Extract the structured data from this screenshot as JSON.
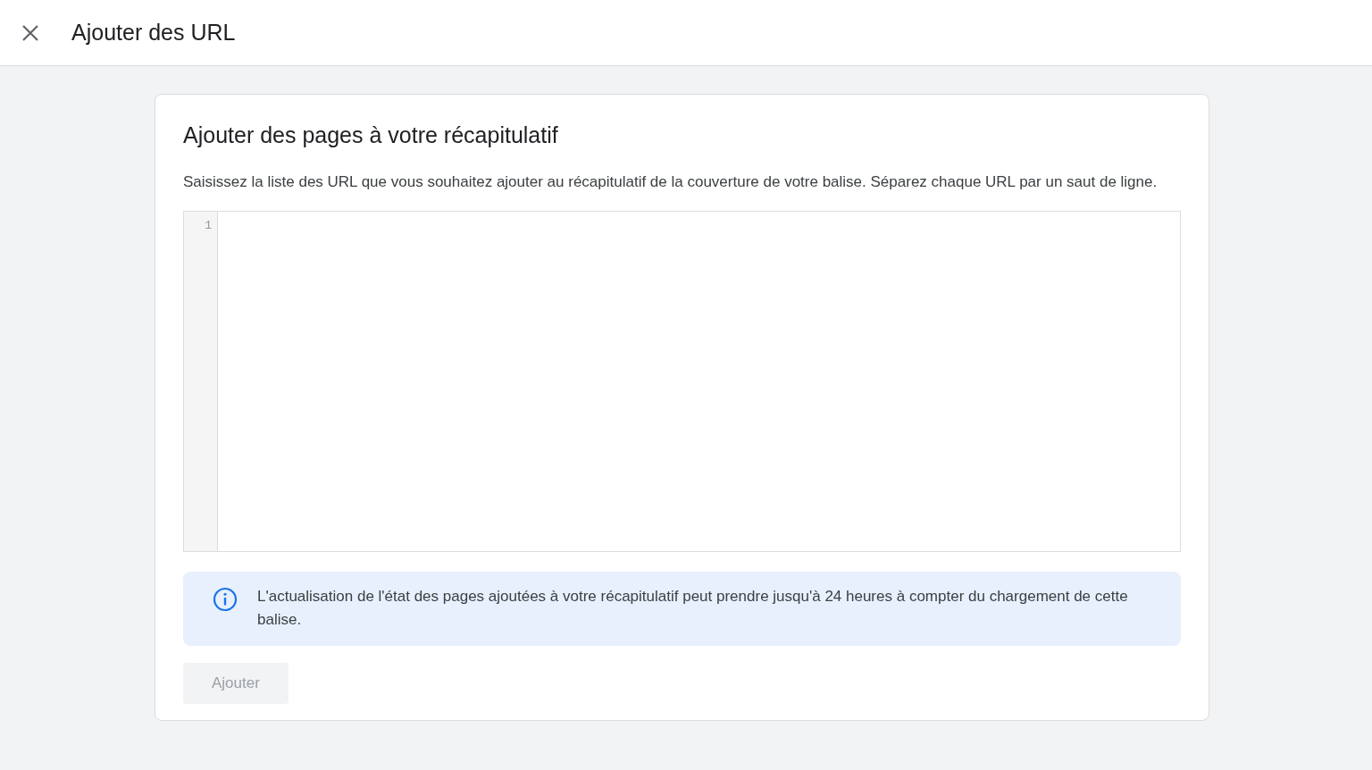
{
  "header": {
    "title": "Ajouter des URL"
  },
  "card": {
    "heading": "Ajouter des pages à votre récapitulatif",
    "description": "Saisissez la liste des URL que vous souhaitez ajouter au récapitulatif de la couverture de votre balise. Séparez chaque URL par un saut de ligne.",
    "editor": {
      "line_numbers": [
        "1"
      ]
    },
    "info": {
      "text": "L'actualisation de l'état des pages ajoutées à votre récapitulatif peut prendre jusqu'à 24 heures à compter du chargement de cette balise."
    },
    "button": {
      "label": "Ajouter",
      "disabled": true
    }
  }
}
